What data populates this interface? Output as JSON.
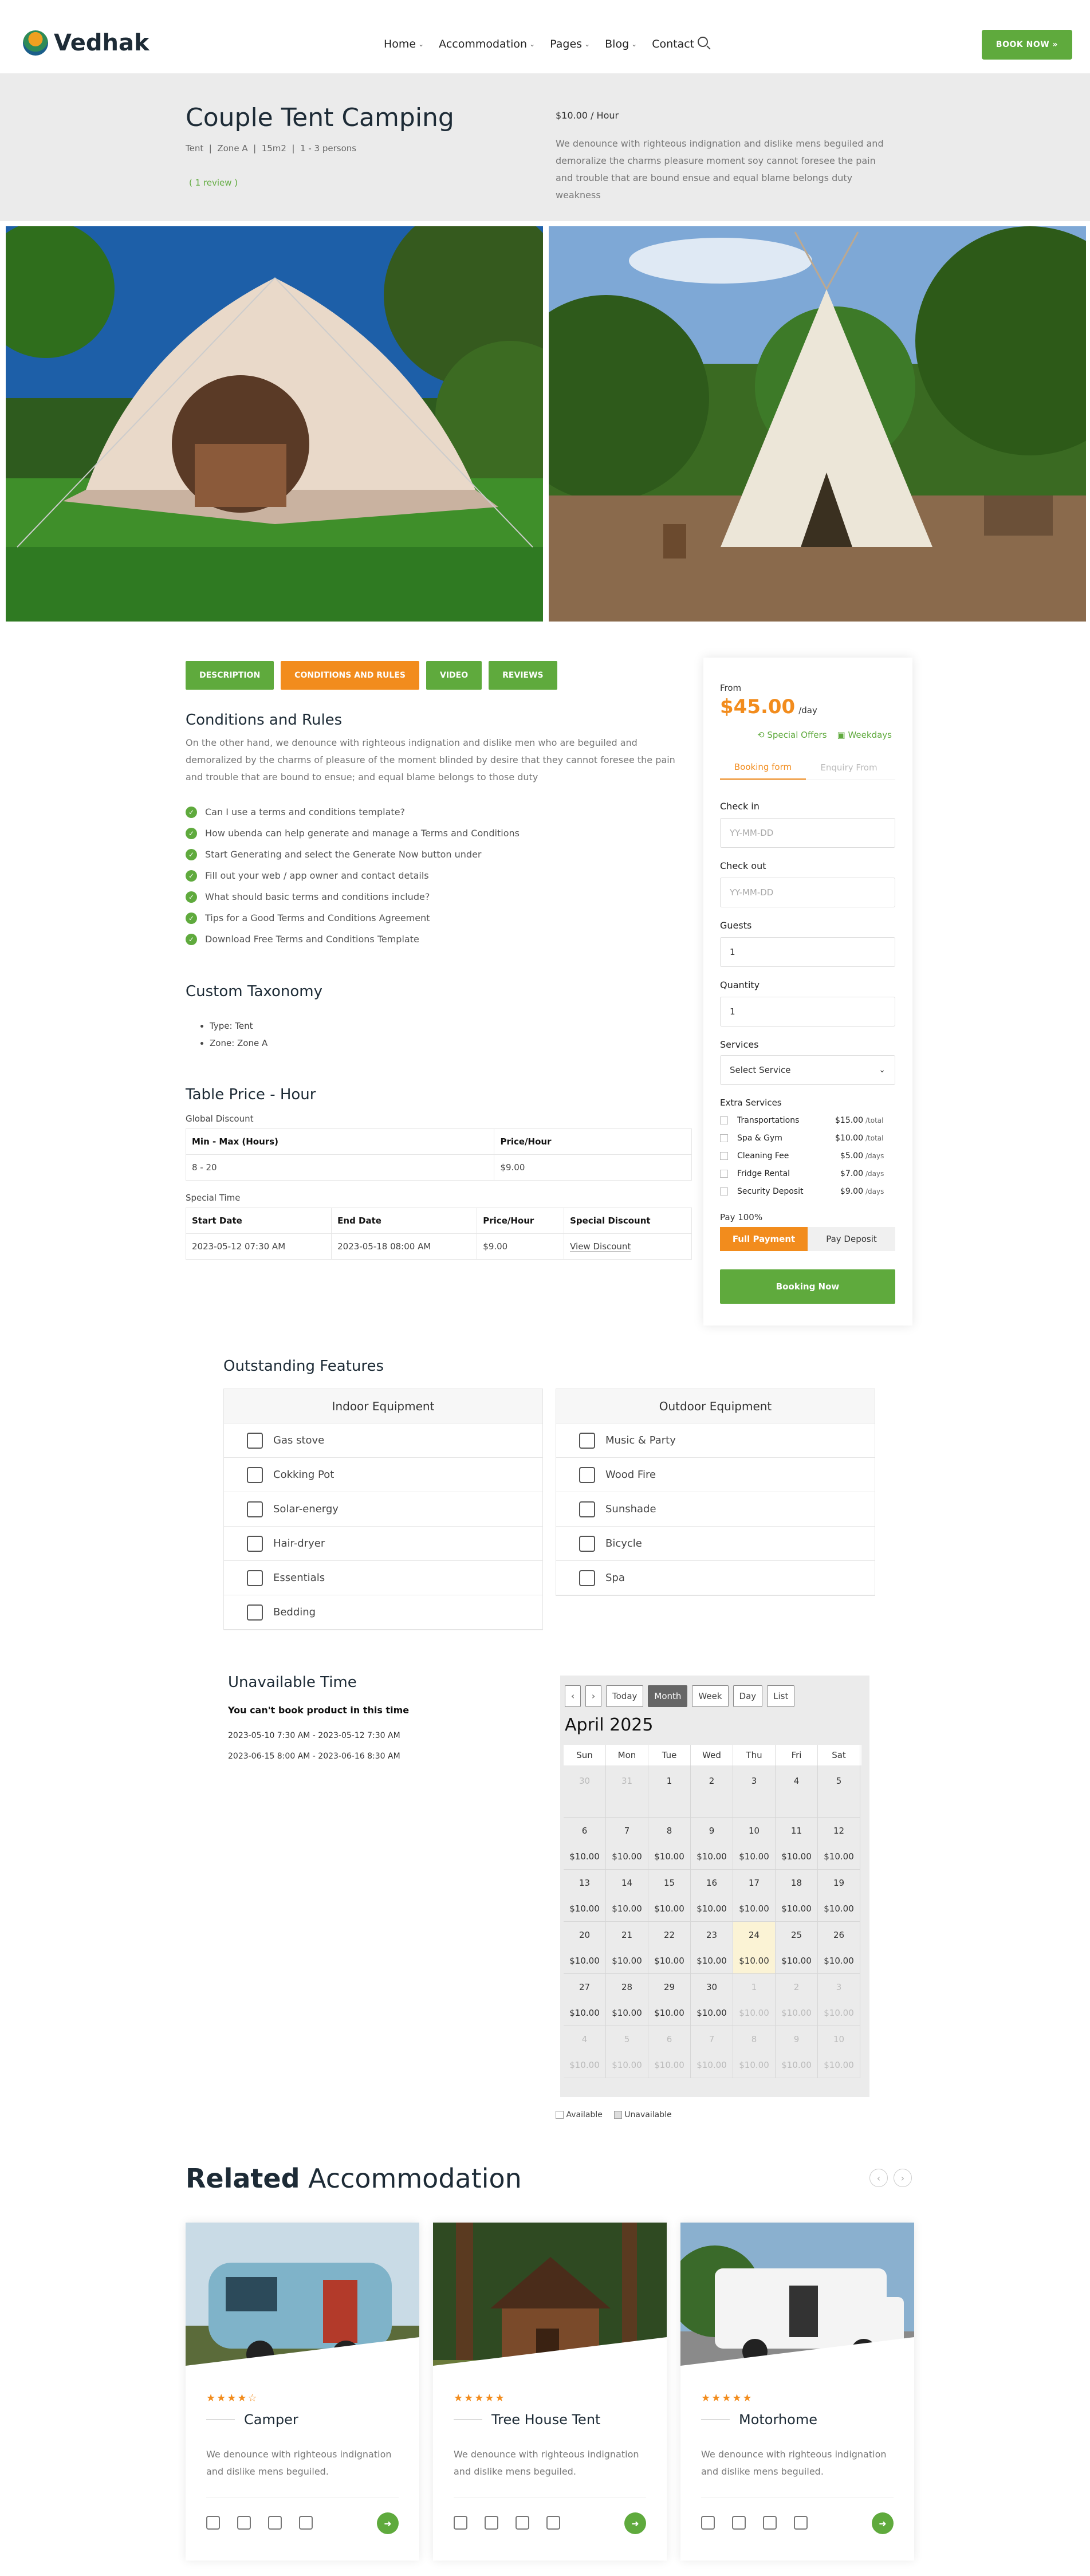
{
  "header": {
    "logo": "Vedhak",
    "nav": [
      "Home",
      "Accommodation",
      "Pages",
      "Blog",
      "Contact"
    ],
    "nav_dropdown": [
      true,
      true,
      true,
      true,
      false
    ],
    "book_btn": "BOOK NOW »"
  },
  "hero": {
    "title": "Couple Tent Camping",
    "meta": "Tent  |  Zone A  |  15m2  |  1 - 3 persons",
    "review": "( 1 review )",
    "price": "$10.00 / Hour",
    "description": "We denounce with righteous indignation and dislike mens beguiled and demoralize the charms pleasure moment soy cannot foresee the pain and trouble that are bound ensue and equal blame belongs duty weakness"
  },
  "tabs": [
    "DESCRIPTION",
    "CONDITIONS AND RULES",
    "VIDEO",
    "REVIEWS"
  ],
  "conditions": {
    "heading": "Conditions and Rules",
    "text": "On the other hand, we denounce with righteous indignation and dislike men who are beguiled and demoralized by the charms of pleasure of the moment blinded by desire that they cannot foresee the pain and trouble that are bound to ensue; and equal blame belongs to those duty",
    "list": [
      "Can I use a terms and conditions template?",
      "How ubenda can help generate and manage a Terms and Conditions",
      "Start Generating and select the Generate Now button under",
      "Fill out your web / app owner and contact details",
      "What should basic terms and conditions include?",
      "Tips for a Good Terms and Conditions Agreement",
      "Download Free Terms and Conditions Template"
    ]
  },
  "taxonomy": {
    "heading": "Custom Taxonomy",
    "items": [
      "Type: Tent",
      "Zone: Zone A"
    ]
  },
  "table_price": {
    "heading": "Table Price - Hour",
    "global_label": "Global Discount",
    "global_headers": [
      "Min - Max (Hours)",
      "Price/Hour"
    ],
    "global_rows": [
      [
        "8 - 20",
        "$9.00"
      ]
    ],
    "special_label": "Special Time",
    "special_headers": [
      "Start Date",
      "End Date",
      "Price/Hour",
      "Special Discount"
    ],
    "special_rows": [
      [
        "2023-05-12 07:30 AM",
        "2023-05-18 08:00 AM",
        "$9.00",
        "View Discount"
      ]
    ]
  },
  "booking": {
    "from": "From",
    "price": "$45.00",
    "per": "/day",
    "special": "Special Offers",
    "weekdays": "Weekdays",
    "tab_booking": "Booking form",
    "tab_enquiry": "Enquiry From",
    "checkin_label": "Check in",
    "checkin_ph": "YY-MM-DD",
    "checkout_label": "Check out",
    "checkout_ph": "YY-MM-DD",
    "guests_label": "Guests",
    "guests_val": "1",
    "qty_label": "Quantity",
    "qty_val": "1",
    "services_label": "Services",
    "services_val": "Select Service",
    "extra_label": "Extra Services",
    "extras": [
      {
        "name": "Transportations",
        "price": "$15.00",
        "unit": "/total"
      },
      {
        "name": "Spa & Gym",
        "price": "$10.00",
        "unit": "/total"
      },
      {
        "name": "Cleaning Fee",
        "price": "$5.00",
        "unit": "/days"
      },
      {
        "name": "Fridge Rental",
        "price": "$7.00",
        "unit": "/days"
      },
      {
        "name": "Security Deposit",
        "price": "$9.00",
        "unit": "/days"
      }
    ],
    "pay_label": "Pay 100%",
    "full_payment": "Full Payment",
    "pay_deposit": "Pay Deposit",
    "book_btn": "Booking Now"
  },
  "features": {
    "heading": "Outstanding Features",
    "indoor_title": "Indoor Equipment",
    "indoor": [
      "Gas stove",
      "Cokking Pot",
      "Solar-energy",
      "Hair-dryer",
      "Essentials",
      "Bedding"
    ],
    "outdoor_title": "Outdoor Equipment",
    "outdoor": [
      "Music & Party",
      "Wood Fire",
      "Sunshade",
      "Bicycle",
      "Spa"
    ]
  },
  "unavailable": {
    "heading": "Unavailable Time",
    "note": "You can't book product in this time",
    "times": [
      "2023-05-10 7:30 AM - 2023-05-12 7:30 AM",
      "2023-06-15 8:00 AM - 2023-06-16 8:30 AM"
    ]
  },
  "calendar": {
    "prev": "‹",
    "next": "›",
    "today": "Today",
    "views": [
      "Month",
      "Week",
      "Day",
      "List"
    ],
    "month": "April 2025",
    "days": [
      "Sun",
      "Mon",
      "Tue",
      "Wed",
      "Thu",
      "Fri",
      "Sat"
    ],
    "weeks": [
      [
        [
          "30",
          "",
          true
        ],
        [
          "31",
          "",
          true
        ],
        [
          "1",
          "",
          false
        ],
        [
          "2",
          "",
          false
        ],
        [
          "3",
          "",
          false
        ],
        [
          "4",
          "",
          false
        ],
        [
          "5",
          "",
          false
        ]
      ],
      [
        [
          "6",
          "$10.00",
          false
        ],
        [
          "7",
          "$10.00",
          false
        ],
        [
          "8",
          "$10.00",
          false
        ],
        [
          "9",
          "$10.00",
          false
        ],
        [
          "10",
          "$10.00",
          false
        ],
        [
          "11",
          "$10.00",
          false
        ],
        [
          "12",
          "$10.00",
          false
        ]
      ],
      [
        [
          "13",
          "$10.00",
          false
        ],
        [
          "14",
          "$10.00",
          false
        ],
        [
          "15",
          "$10.00",
          false
        ],
        [
          "16",
          "$10.00",
          false
        ],
        [
          "17",
          "$10.00",
          false
        ],
        [
          "18",
          "$10.00",
          false
        ],
        [
          "19",
          "$10.00",
          false
        ]
      ],
      [
        [
          "20",
          "$10.00",
          false
        ],
        [
          "21",
          "$10.00",
          false
        ],
        [
          "22",
          "$10.00",
          false
        ],
        [
          "23",
          "$10.00",
          false
        ],
        [
          "24",
          "$10.00",
          false
        ],
        [
          "25",
          "$10.00",
          false
        ],
        [
          "26",
          "$10.00",
          false
        ]
      ],
      [
        [
          "27",
          "$10.00",
          false
        ],
        [
          "28",
          "$10.00",
          false
        ],
        [
          "29",
          "$10.00",
          false
        ],
        [
          "30",
          "$10.00",
          false
        ],
        [
          "1",
          "$10.00",
          true
        ],
        [
          "2",
          "$10.00",
          true
        ],
        [
          "3",
          "$10.00",
          true
        ]
      ],
      [
        [
          "4",
          "$10.00",
          true
        ],
        [
          "5",
          "$10.00",
          true
        ],
        [
          "6",
          "$10.00",
          true
        ],
        [
          "7",
          "$10.00",
          true
        ],
        [
          "8",
          "$10.00",
          true
        ],
        [
          "9",
          "$10.00",
          true
        ],
        [
          "10",
          "$10.00",
          true
        ]
      ]
    ],
    "legend_available": "Available",
    "legend_unavailable": "Unavailable"
  },
  "related": {
    "heading_bold": "Related",
    "heading_light": "Accommodation",
    "cards": [
      {
        "title": "Camper",
        "stars": "★★★★☆",
        "text": "We denounce with righteous indignation and dislike mens beguiled."
      },
      {
        "title": "Tree House Tent",
        "stars": "★★★★★",
        "text": "We denounce with righteous indignation and dislike mens beguiled."
      },
      {
        "title": "Motorhome",
        "stars": "★★★★★",
        "text": "We denounce with righteous indignation and dislike mens beguiled."
      }
    ]
  },
  "colors": {
    "green": "#5faa3d",
    "orange": "#f28c1d",
    "dark": "#1d2b36"
  }
}
